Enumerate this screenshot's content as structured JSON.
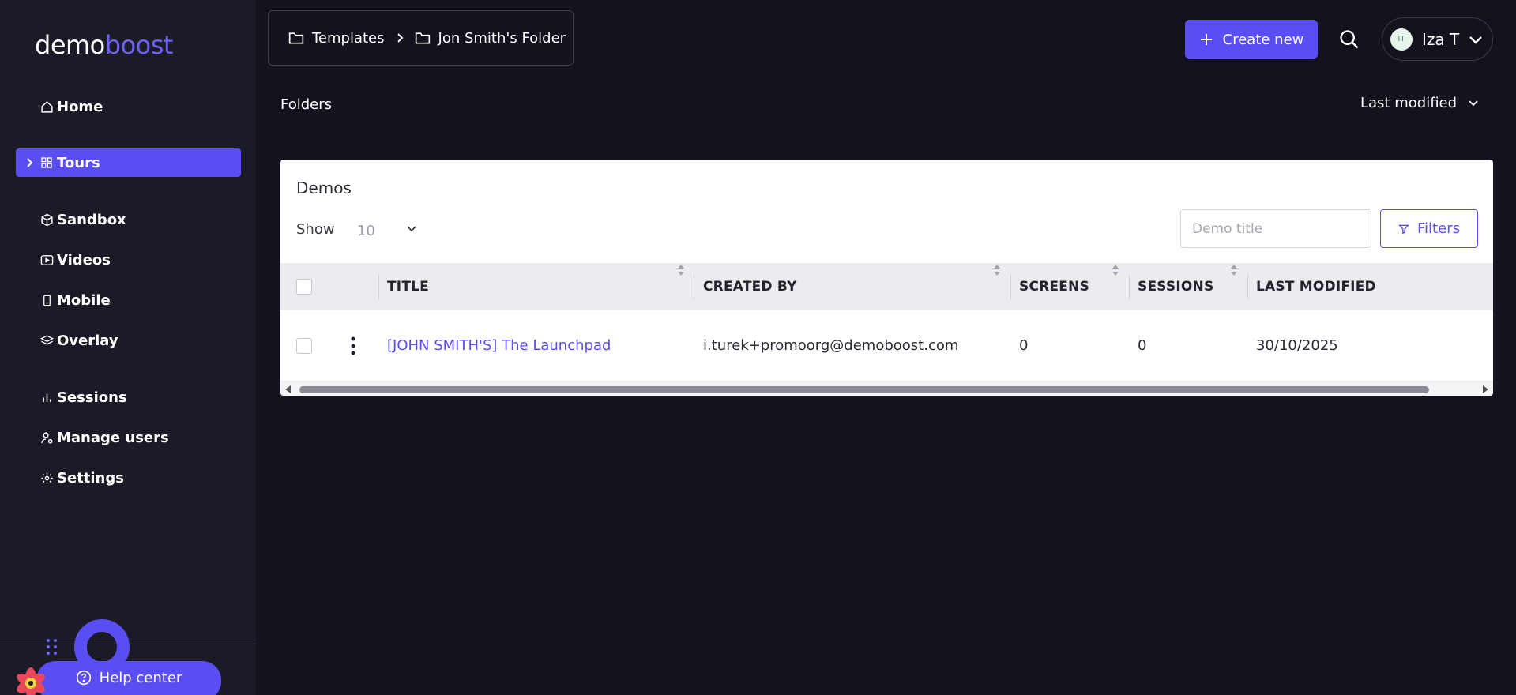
{
  "brand": {
    "logo_part1": "demo",
    "logo_part2": "boost",
    "colors": {
      "accent": "#5a4ef2",
      "logo_accent": "#6e62f5",
      "sidebar_bg": "#1b1b28",
      "page_bg": "#13131e"
    }
  },
  "sidebar": {
    "items": [
      {
        "label": "Home",
        "icon": "home-icon",
        "active": false
      },
      {
        "label": "Tours",
        "icon": "grid-icon",
        "active": true
      },
      {
        "label": "Sandbox",
        "icon": "cube-icon",
        "active": false
      },
      {
        "label": "Videos",
        "icon": "video-icon",
        "active": false
      },
      {
        "label": "Mobile",
        "icon": "mobile-icon",
        "active": false
      },
      {
        "label": "Overlay",
        "icon": "layers-icon",
        "active": false
      },
      {
        "label": "Sessions",
        "icon": "bar-chart-icon",
        "active": false
      },
      {
        "label": "Manage users",
        "icon": "user-cog-icon",
        "active": false
      },
      {
        "label": "Settings",
        "icon": "gear-icon",
        "active": false
      }
    ],
    "help_label": "Help center"
  },
  "breadcrumb": {
    "items": [
      "Templates",
      "Jon Smith's Folder"
    ]
  },
  "header": {
    "create_label": "Create new",
    "user": {
      "initials": "IT",
      "name": "Iza T"
    }
  },
  "folders": {
    "title": "Folders",
    "sort_label": "Last modified"
  },
  "demos": {
    "title": "Demos",
    "show_label": "Show",
    "page_size": "10",
    "search_placeholder": "Demo title",
    "filters_label": "Filters",
    "columns": [
      "TITLE",
      "CREATED BY",
      "SCREENS",
      "SESSIONS",
      "LAST MODIFIED"
    ],
    "rows": [
      {
        "title": "[JOHN SMITH'S] The Launchpad",
        "created_by": "i.turek+promoorg@demoboost.com",
        "screens": "0",
        "sessions": "0",
        "last_modified": "30/10/2025"
      }
    ]
  }
}
